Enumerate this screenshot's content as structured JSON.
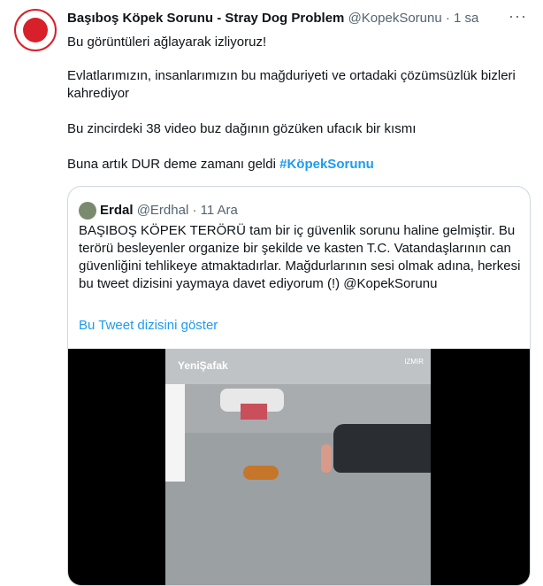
{
  "tweet": {
    "display_name": "Başıboş Köpek Sorunu - Stray Dog Problem",
    "handle": "@KopekSorunu",
    "separator": "·",
    "time": "1 sa",
    "more_label": "···",
    "paragraph1": "Bu görüntüleri ağlayarak izliyoruz!",
    "paragraph2": "Evlatlarımızın, insanlarımızın bu mağduriyeti ve ortadaki çözümsüzlük bizleri kahrediyor",
    "paragraph3": "Bu zincirdeki 38 video buz dağının gözüken ufacık bir kısmı",
    "paragraph4_text": "Buna artık DUR deme zamanı geldi ",
    "hashtag": "#KöpekSorunu"
  },
  "quoted": {
    "display_name": "Erdal",
    "handle": "@Erdhal",
    "separator": "·",
    "time": "11 Ara",
    "text": "BAŞIBOŞ KÖPEK TERÖRÜ tam bir iç güvenlik sorunu haline gelmiştir. Bu terörü besleyenler organize bir şekilde ve kasten T.C. Vatandaşlarının can güvenliğini tehlikeye atmaktadırlar. Mağdurlarının sesi olmak adına, herkesi bu tweet dizisini yaymaya davet ediyorum (!) @KopekSorunu",
    "thread_link": "Bu Tweet dizisini göster",
    "video_logo": "YeniŞafak",
    "video_corner": "IZMIR"
  }
}
